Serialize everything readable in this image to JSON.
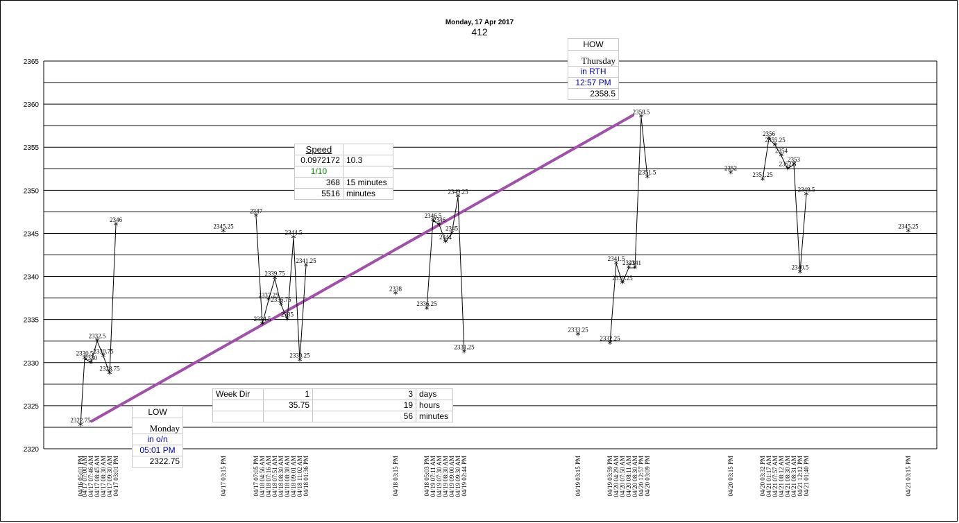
{
  "header": {
    "title": "Monday, 17 Apr 2017",
    "subtitle": "412"
  },
  "speed_box": {
    "title": "Speed",
    "rows": [
      [
        "0.0972172",
        "10.3"
      ],
      [
        "1/10",
        ""
      ],
      [
        "368",
        "15 minutes"
      ],
      [
        "5516",
        "minutes"
      ]
    ],
    "accent_color": "#008000"
  },
  "week_box": {
    "rows": [
      [
        "Week Dir",
        "1",
        "3",
        "days"
      ],
      [
        "",
        "35.75",
        "19",
        "hours"
      ],
      [
        "",
        "",
        "56",
        "minutes"
      ]
    ]
  },
  "low_box": {
    "label": "LOW",
    "day": "Monday",
    "session": "in o/n",
    "time": "05:01 PM",
    "price": "2322.75"
  },
  "high_box": {
    "label": "HOW",
    "day": "Thursday",
    "session": "in RTH",
    "time": "12:57 PM",
    "price": "2358.5"
  },
  "chart_data": {
    "type": "line",
    "ylim": [
      2320,
      2365
    ],
    "yticks": [
      2320,
      2325,
      2330,
      2335,
      2340,
      2345,
      2350,
      2355,
      2360,
      2365
    ],
    "line_color": "#000000",
    "trend_color": "#a050a8",
    "trend": {
      "from": [
        "04/16 05:01 PM",
        2323.2
      ],
      "to": [
        "04/20 12:57 PM",
        2358.7
      ]
    },
    "series": [
      {
        "points": [
          {
            "x": "04/16 05:01 PM",
            "y": 2322.75,
            "label": "2322.75"
          },
          {
            "x": "04/17 07:00 AM",
            "y": 2330.5,
            "label": "2330.5"
          },
          {
            "x": "04/17 07:46 AM",
            "y": 2330,
            "label": "2330"
          },
          {
            "x": "04/17 08:45 AM",
            "y": 2332.5,
            "label": "2332.5"
          },
          {
            "x": "04/17 08:30 AM",
            "y": 2330.75,
            "label": "2330.75"
          },
          {
            "x": "04/17 09:30 AM",
            "y": 2328.75,
            "label": "2328.75"
          },
          {
            "x": "04/17 03:01 PM",
            "y": 2346,
            "label": "2346"
          }
        ]
      },
      {
        "points": [
          {
            "x": "04/17 03:15 PM",
            "y": 2345.25,
            "label": "2345.25"
          }
        ]
      },
      {
        "points": [
          {
            "x": "04/17 07:05 PM",
            "y": 2347,
            "label": "2347"
          },
          {
            "x": "04/18 04:56 AM",
            "y": 2334.5,
            "label": "2334.5"
          },
          {
            "x": "04/18 07:16 AM",
            "y": 2337.25,
            "label": "2337.25"
          },
          {
            "x": "04/18 07:51 AM",
            "y": 2339.75,
            "label": "2339.75"
          },
          {
            "x": "04/18 08:30 AM",
            "y": 2336.75,
            "label": "2336.75"
          },
          {
            "x": "04/18 08:38 AM",
            "y": 2335,
            "label": "2335"
          },
          {
            "x": "04/18 09:01 AM",
            "y": 2344.5,
            "label": "2344.5"
          },
          {
            "x": "04/18 11:02 AM",
            "y": 2330.25,
            "label": "2330.25"
          },
          {
            "x": "04/18 01:36 PM",
            "y": 2341.25,
            "label": "2341.25"
          }
        ]
      },
      {
        "points": [
          {
            "x": "04/18 03:15 PM",
            "y": 2338,
            "label": "2338"
          }
        ]
      },
      {
        "points": [
          {
            "x": "04/18 05:03 PM",
            "y": 2336.25,
            "label": "2336.25"
          },
          {
            "x": "04/19 07:11 AM",
            "y": 2346.5,
            "label": "2346.5"
          },
          {
            "x": "04/19 07:30 AM",
            "y": 2346,
            "label": "2346"
          },
          {
            "x": "04/19 08:30 AM",
            "y": 2344,
            "label": "2344"
          },
          {
            "x": "04/19 09:00 AM",
            "y": 2345,
            "label": "2345"
          },
          {
            "x": "04/19 09:30 AM",
            "y": 2349.25,
            "label": "2349.25"
          },
          {
            "x": "04/19 02:44 PM",
            "y": 2331.25,
            "label": "2331.25"
          }
        ]
      },
      {
        "points": [
          {
            "x": "04/19 03:15 PM",
            "y": 2333.25,
            "label": "2333.25"
          }
        ]
      },
      {
        "points": [
          {
            "x": "04/19 03:59 PM",
            "y": 2332.25,
            "label": "2332.25"
          },
          {
            "x": "04/20 04:29 AM",
            "y": 2341.5,
            "label": "2341.5"
          },
          {
            "x": "04/20 07:50 AM",
            "y": 2339.25,
            "label": "2339.25"
          },
          {
            "x": "04/20 08:11 AM",
            "y": 2341,
            "label": "2341"
          },
          {
            "x": "04/20 08:30 AM",
            "y": 2341,
            "label": "2341"
          },
          {
            "x": "04/20 12:57 PM",
            "y": 2358.5,
            "label": "2358.5"
          },
          {
            "x": "04/20 03:09 PM",
            "y": 2351.5,
            "label": "2351.5"
          }
        ]
      },
      {
        "points": [
          {
            "x": "04/20 03:15 PM",
            "y": 2352,
            "label": "2352"
          }
        ]
      },
      {
        "points": [
          {
            "x": "04/20 03:32 PM",
            "y": 2351.25,
            "label": "2351.25"
          },
          {
            "x": "04/21 01:17 AM",
            "y": 2356,
            "label": "2356"
          },
          {
            "x": "04/21 07:57 AM",
            "y": 2355.25,
            "label": "2355.25"
          },
          {
            "x": "04/21 08:12 AM",
            "y": 2354,
            "label": "2354"
          },
          {
            "x": "04/21 08:30 AM",
            "y": 2352.5,
            "label": "2352.5"
          },
          {
            "x": "04/21 08:31 AM",
            "y": 2353,
            "label": "2353"
          },
          {
            "x": "04/21 12:12 PM",
            "y": 2340.5,
            "label": "2340.5"
          },
          {
            "x": "04/21 01:40 PM",
            "y": 2349.5,
            "label": "2349.5"
          }
        ]
      },
      {
        "points": [
          {
            "x": "04/21 03:15 PM",
            "y": 2345.25,
            "label": "2345.25"
          }
        ]
      }
    ]
  }
}
